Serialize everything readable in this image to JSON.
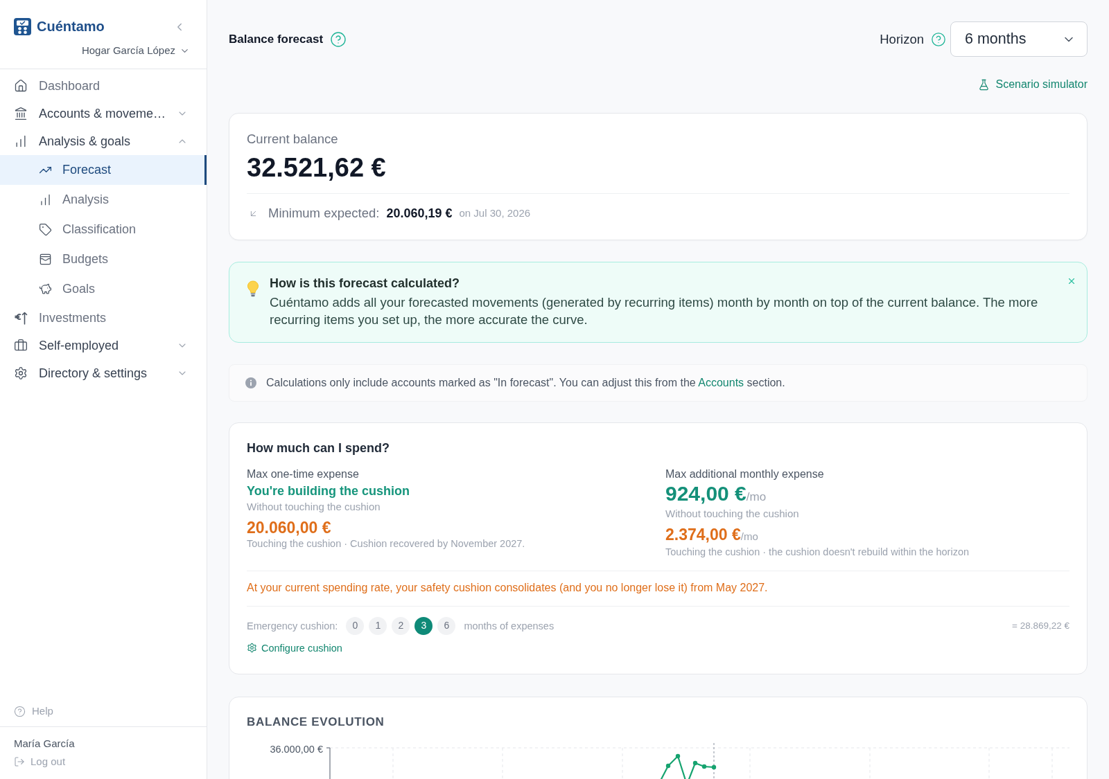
{
  "sidebar": {
    "brand": "Cuéntamo",
    "household": "Hogar García López",
    "nav": [
      {
        "label": "Dashboard",
        "kind": "link",
        "selected": false
      },
      {
        "label": "Accounts & moveme…",
        "kind": "group",
        "expanded": false,
        "selected": false
      },
      {
        "label": "Analysis & goals",
        "kind": "group",
        "expanded": true,
        "selected": false,
        "children": [
          {
            "label": "Forecast",
            "selected": true
          },
          {
            "label": "Analysis",
            "selected": false
          },
          {
            "label": "Classification",
            "selected": false
          },
          {
            "label": "Budgets",
            "selected": false
          },
          {
            "label": "Goals",
            "selected": false
          }
        ]
      },
      {
        "label": "Investments",
        "kind": "link",
        "selected": false
      },
      {
        "label": "Self-employed",
        "kind": "group",
        "expanded": false,
        "selected": false
      },
      {
        "label": "Directory & settings",
        "kind": "group",
        "expanded": false,
        "selected": false
      }
    ],
    "help": "Help",
    "user": {
      "name": "María García",
      "logout": "Log out"
    }
  },
  "header": {
    "title": "Balance forecast",
    "horizon": {
      "label": "Horizon",
      "value": "6 months"
    },
    "scenario_link": "Scenario simulator"
  },
  "balance_card": {
    "label": "Current balance",
    "amount": "32.521,62 €",
    "minimum_label": "Minimum expected:",
    "minimum_amount": "20.060,19 €",
    "minimum_date": "on Jul 30, 2026"
  },
  "info_banner": {
    "title": "How is this forecast calculated?",
    "body": "Cuéntamo adds all your forecasted movements (generated by recurring items) month by month on top of the current balance. The more recurring items you set up, the more accurate the curve."
  },
  "notice": {
    "text_before": "Calculations only include accounts marked as \"In forecast\". You can adjust this from the",
    "link": "Accounts",
    "text_after": "section."
  },
  "spend_card": {
    "title": "How much can I spend?",
    "one_time": {
      "label": "Max one-time expense",
      "status": "You're building the cushion",
      "status_note": "Without touching the cushion",
      "amount": "20.060,00 €",
      "amount_note": "Touching the cushion · Cushion recovered by November 2027."
    },
    "monthly": {
      "label": "Max additional monthly expense",
      "amount": "924,00 €",
      "unit": "/mo",
      "amount_note": "Without touching the cushion",
      "cushion_amount": "2.374,00 €",
      "cushion_unit": "/mo",
      "cushion_note": "Touching the cushion · the cushion doesn't rebuild within the horizon"
    },
    "alert": "At your current spending rate, your safety cushion consolidates (and you no longer lose it) from May 2027.",
    "cushion": {
      "label": "Emergency cushion:",
      "options": [
        {
          "label": "0",
          "selected": false
        },
        {
          "label": "1",
          "selected": false
        },
        {
          "label": "2",
          "selected": false
        },
        {
          "label": "3",
          "selected": true
        },
        {
          "label": "6",
          "selected": false
        }
      ],
      "unit": "months of expenses",
      "total": "= 28.869,22 €",
      "configure": "Configure cushion"
    }
  },
  "balance_evolution": {
    "title": "BALANCE EVOLUTION",
    "y_tick": "36.000,00 €"
  }
}
